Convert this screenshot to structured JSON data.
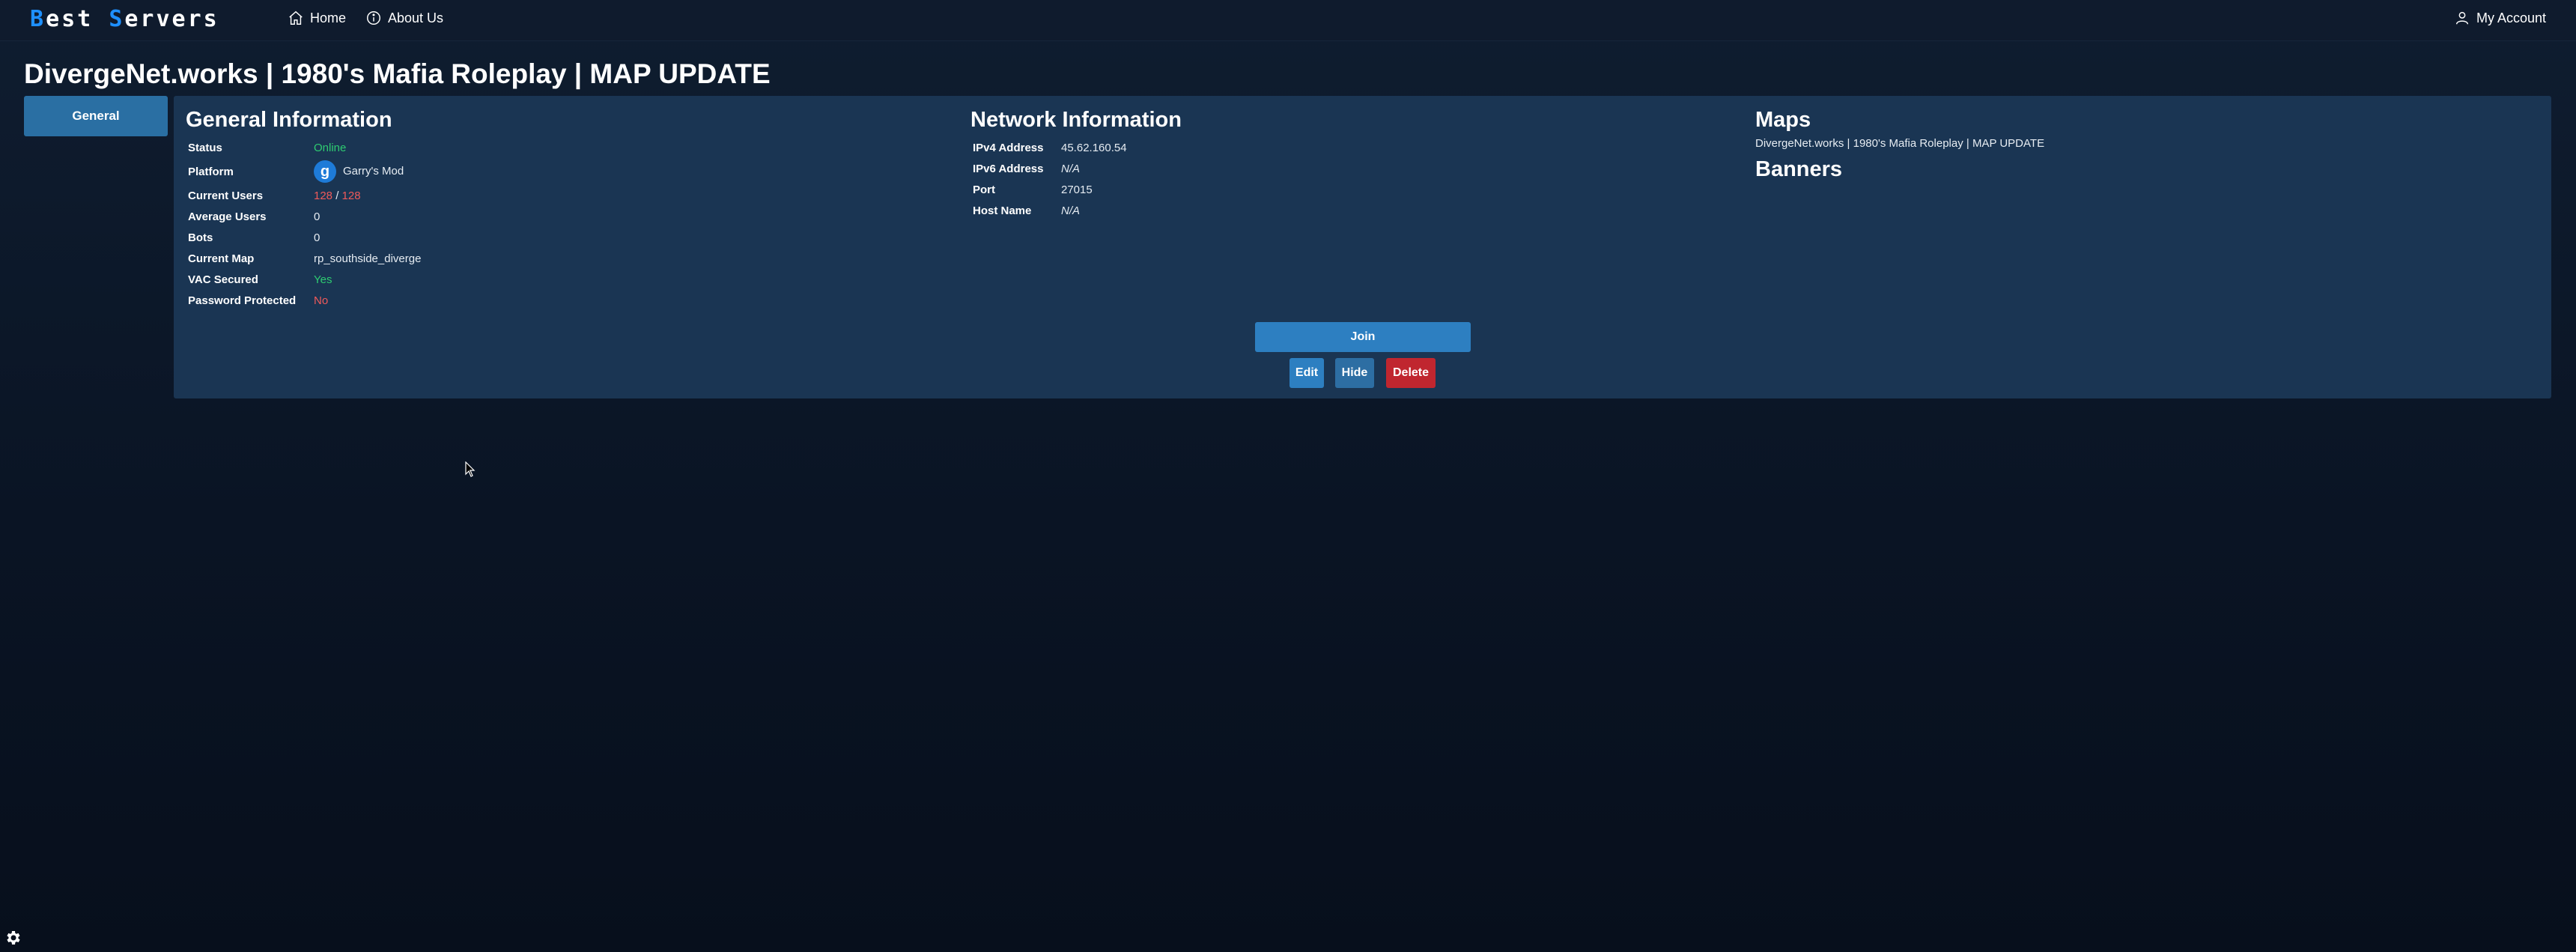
{
  "nav": {
    "logo_first_letter": "B",
    "logo_first_rest": "est",
    "logo_second_letter": "S",
    "logo_second_rest": "ervers",
    "home_label": "Home",
    "about_label": "About Us",
    "account_label": "My Account",
    "icons": [
      "home-icon",
      "info-icon",
      "user-icon"
    ]
  },
  "page_title": "DivergeNet.works | 1980's Mafia Roleplay | MAP UPDATE",
  "sidebar": {
    "tabs": [
      {
        "label": "General",
        "active": true
      }
    ]
  },
  "general": {
    "title": "General Information",
    "status_label": "Status",
    "status_value": "Online",
    "platform_label": "Platform",
    "platform_value": "Garry's Mod",
    "platform_icon": "gmod-icon",
    "platform_icon_glyph": "g",
    "current_users_label": "Current Users",
    "current_users": "128",
    "users_separator": "/",
    "max_users": "128",
    "average_users_label": "Average Users",
    "average_users_value": "0",
    "bots_label": "Bots",
    "bots_value": "0",
    "current_map_label": "Current Map",
    "current_map_value": "rp_southside_diverge",
    "vac_label": "VAC Secured",
    "vac_value": "Yes",
    "password_label": "Password Protected",
    "password_value": "No"
  },
  "network": {
    "title": "Network Information",
    "ipv4_label": "IPv4 Address",
    "ipv4_value": "45.62.160.54",
    "ipv6_label": "IPv6 Address",
    "ipv6_value": "N/A",
    "port_label": "Port",
    "port_value": "27015",
    "hostname_label": "Host Name",
    "hostname_value": "N/A"
  },
  "maps": {
    "title": "Maps",
    "line": "DivergeNet.works | 1980's Mafia Roleplay | MAP UPDATE",
    "banners_title": "Banners"
  },
  "actions": {
    "join": "Join",
    "edit": "Edit",
    "hide": "Hide",
    "delete": "Delete"
  },
  "colors": {
    "accent": "#2d7fc1",
    "online": "#2ecc71",
    "negative": "#f05a5a",
    "delete": "#c0262f",
    "panel": "#1a3553",
    "background": "#0a1424"
  },
  "footer": {
    "settings_icon": "gear-icon"
  }
}
